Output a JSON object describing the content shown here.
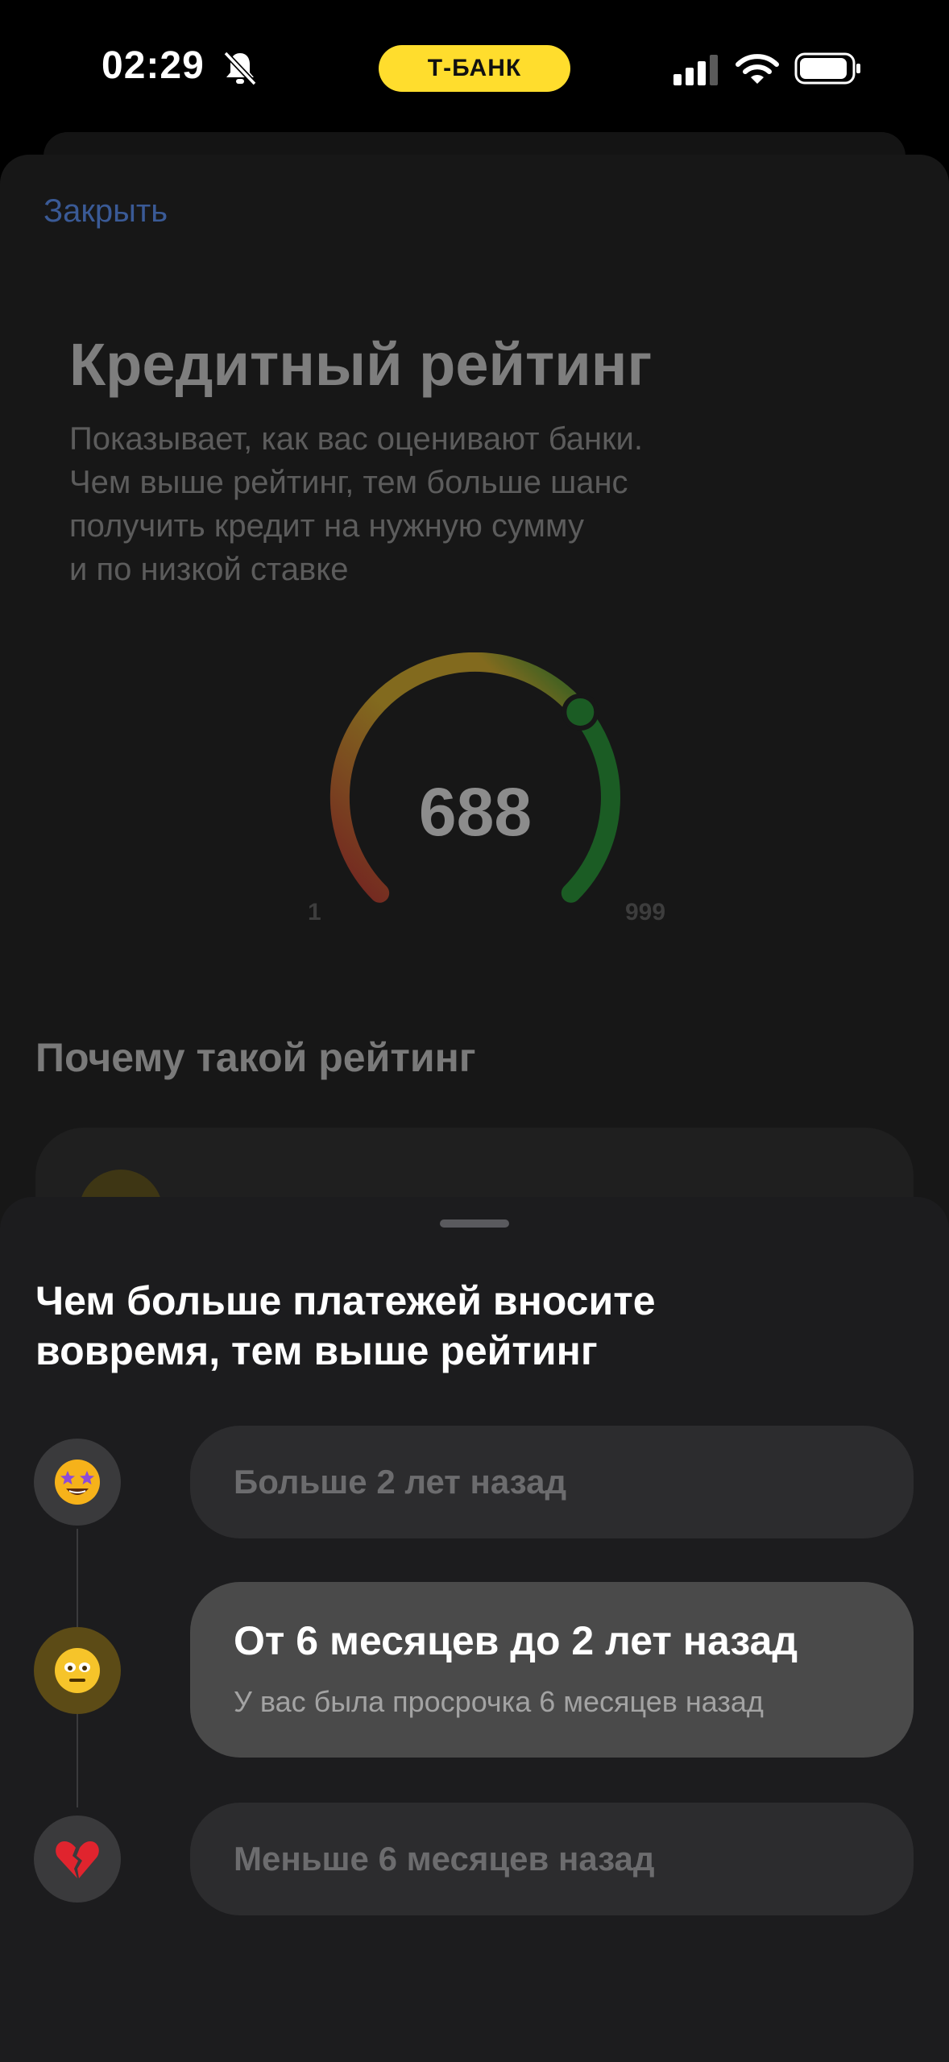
{
  "status_bar": {
    "time": "02:29",
    "carrier_pill": "T‑БАНК",
    "pill_color": "#ffdd2d",
    "icons": [
      "bell-slash-icon",
      "signal-icon",
      "wifi-icon",
      "battery-icon"
    ]
  },
  "background_screen": {
    "close_label": "Закрыть",
    "title": "Кредитный рейтинг",
    "subtitle_lines": [
      "Показывает, как вас оценивают банки.",
      "Чем выше рейтинг, тем больше шанс",
      "получить кредит на нужную сумму",
      "и по низкой ставке"
    ],
    "gauge": {
      "score": "688",
      "min": "1",
      "max": "999",
      "score_value": 688,
      "min_value": 1,
      "max_value": 999,
      "colors": [
        "#b02a28",
        "#c9a223",
        "#1e8a2e"
      ]
    },
    "section_title": "Почему такой рейтинг"
  },
  "sheet": {
    "title_lines": [
      "Чем больше платежей вносите",
      "вовремя, тем выше рейтинг"
    ],
    "options": [
      {
        "icon": "star-struck-emoji-icon",
        "label": "Больше 2 лет назад",
        "subtext": "",
        "active": false
      },
      {
        "icon": "neutral-face-emoji-icon",
        "label": "От 6 месяцев до 2 лет назад",
        "subtext": "У вас была просрочка 6 месяцев назад",
        "active": true
      },
      {
        "icon": "broken-heart-emoji-icon",
        "label": "Меньше 6 месяцев назад",
        "subtext": "",
        "active": false
      }
    ]
  }
}
